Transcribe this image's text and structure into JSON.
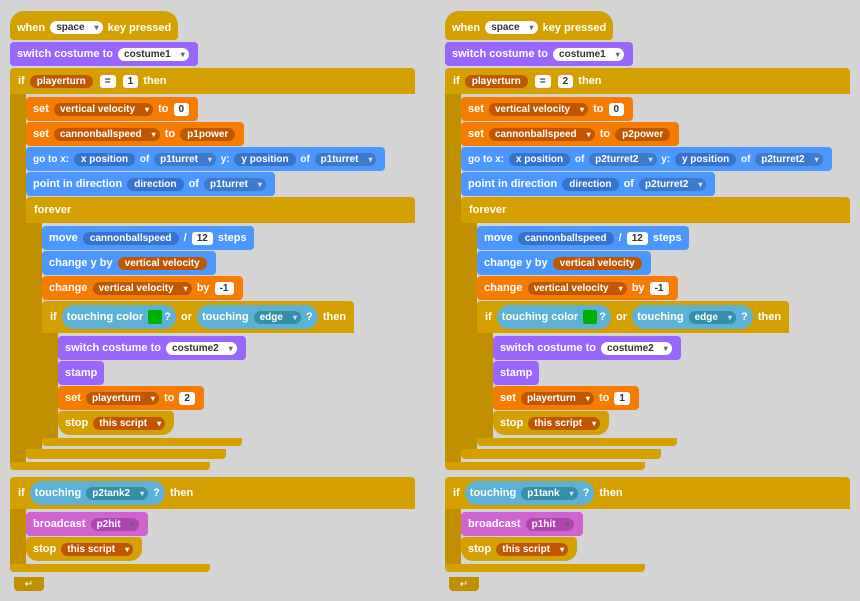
{
  "left": {
    "hat": "when",
    "hat_key": "space",
    "hat_suffix": "key pressed",
    "switch_costume": "switch costume to",
    "costume1": "costume1",
    "if_label": "if",
    "playerturn_var": "playerturn",
    "equals": "=",
    "player1_val": "1",
    "then": "then",
    "set_vy_label": "set",
    "vert_vel": "vertical velocity",
    "to_label": "to",
    "zero": "0",
    "set_cbs_label": "set",
    "cannonballspeed": "cannonballspeed",
    "p1power": "p1power",
    "goto_label": "go to x:",
    "xpos": "x position",
    "of_label": "of",
    "p1turret": "p1turret",
    "y_label": "y:",
    "ypos": "y position",
    "of2": "of",
    "p1turret2": "p1turret",
    "point_label": "point in direction",
    "direction": "direction",
    "of3": "of",
    "p1turret3": "p1turret",
    "forever_label": "forever",
    "move_label": "move",
    "div_label": "/",
    "twelve": "12",
    "steps": "steps",
    "change_y_label": "change y by",
    "change_vv_label": "change",
    "by_neg1": "by",
    "neg1": "-1",
    "if2_label": "if",
    "touching_color": "touching color",
    "green_swatch": "#00ff00",
    "or_label": "or",
    "touching_edge": "touching",
    "edge_dd": "edge",
    "then2": "then",
    "switch_costume2": "switch costume to",
    "costume2": "costume2",
    "stamp": "stamp",
    "set_pt_label": "set",
    "playerturn2": "playerturn",
    "to2": "to",
    "pt_val": "2",
    "stop_label": "stop",
    "this_script": "this script",
    "if3_label": "if",
    "touching_label3": "touching",
    "p2tank": "p2tank2",
    "q3": "?",
    "then3": "then",
    "broadcast_label": "broadcast",
    "p2hit": "p2hit",
    "stop2": "stop",
    "this_script2": "this script"
  },
  "right": {
    "hat": "when",
    "hat_key": "space",
    "hat_suffix": "key pressed",
    "switch_costume": "switch costume to",
    "costume1": "costume1",
    "if_label": "if",
    "playerturn_var": "playerturn",
    "equals": "=",
    "player2_val": "2",
    "then": "then",
    "set_vy_label": "set",
    "vert_vel": "vertical velocity",
    "to_label": "to",
    "zero": "0",
    "set_cbs_label": "set",
    "cannonballspeed": "cannonballspeed",
    "p2power": "p2power",
    "goto_label": "go to x:",
    "xpos": "x position",
    "of_label": "of",
    "p2turret": "p2turret2",
    "y_label": "y:",
    "ypos": "y position",
    "of2": "of",
    "p2turret2": "p2turret2",
    "point_label": "point in direction",
    "direction": "direction",
    "of3": "of",
    "p2turret3": "p2turret2",
    "forever_label": "forever",
    "move_label": "move",
    "div_label": "/",
    "twelve": "12",
    "steps": "steps",
    "change_y_label": "change y by",
    "change_vv_label": "change",
    "by_neg1": "by",
    "neg1": "-1",
    "if2_label": "if",
    "touching_color": "touching color",
    "green_swatch": "#00cc00",
    "or_label": "or",
    "touching_edge": "touching",
    "edge_dd": "edge",
    "then2": "then",
    "switch_costume2": "switch costume to",
    "costume2": "costume2",
    "stamp": "stamp",
    "set_pt_label": "set",
    "playerturn2": "playerturn",
    "to2": "to",
    "pt_val": "1",
    "stop_label": "stop",
    "this_script": "this script",
    "if3_label": "if",
    "touching_label3": "touching",
    "p1tank": "p1tank",
    "q3": "?",
    "then3": "then",
    "broadcast_label": "broadcast",
    "p1hit": "p1hit",
    "stop2": "stop",
    "this_script2": "this script"
  }
}
